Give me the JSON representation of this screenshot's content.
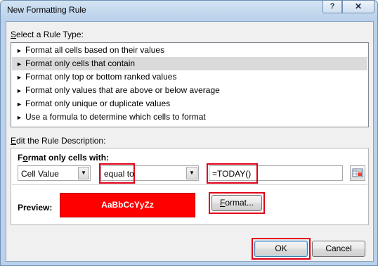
{
  "window": {
    "title": "New Formatting Rule",
    "help_label": "?",
    "close_label": "✕"
  },
  "rule_type": {
    "label_prefix": "",
    "label_accel": "S",
    "label_rest": "elect a Rule Type:",
    "items": [
      {
        "label": "Format all cells based on their values",
        "selected": false
      },
      {
        "label": "Format only cells that contain",
        "selected": true
      },
      {
        "label": "Format only top or bottom ranked values",
        "selected": false
      },
      {
        "label": "Format only values that are above or below average",
        "selected": false
      },
      {
        "label": "Format only unique or duplicate values",
        "selected": false
      },
      {
        "label": "Use a formula to determine which cells to format",
        "selected": false
      }
    ]
  },
  "description": {
    "label_accel": "E",
    "label_rest": "dit the Rule Description:",
    "heading_accel": "o",
    "heading_pre": "F",
    "heading_rest": "rmat only cells with:",
    "condition_type": "Cell Value",
    "operator": "equal to",
    "value": "=TODAY()",
    "preview_label": "Preview:",
    "preview_text": "AaBbCcYyZz",
    "format_button_accel": "F",
    "format_button_rest": "ormat..."
  },
  "buttons": {
    "ok": "OK",
    "cancel": "Cancel"
  },
  "colors": {
    "preview_fill": "#ff0000",
    "highlight": "#e0001a"
  }
}
